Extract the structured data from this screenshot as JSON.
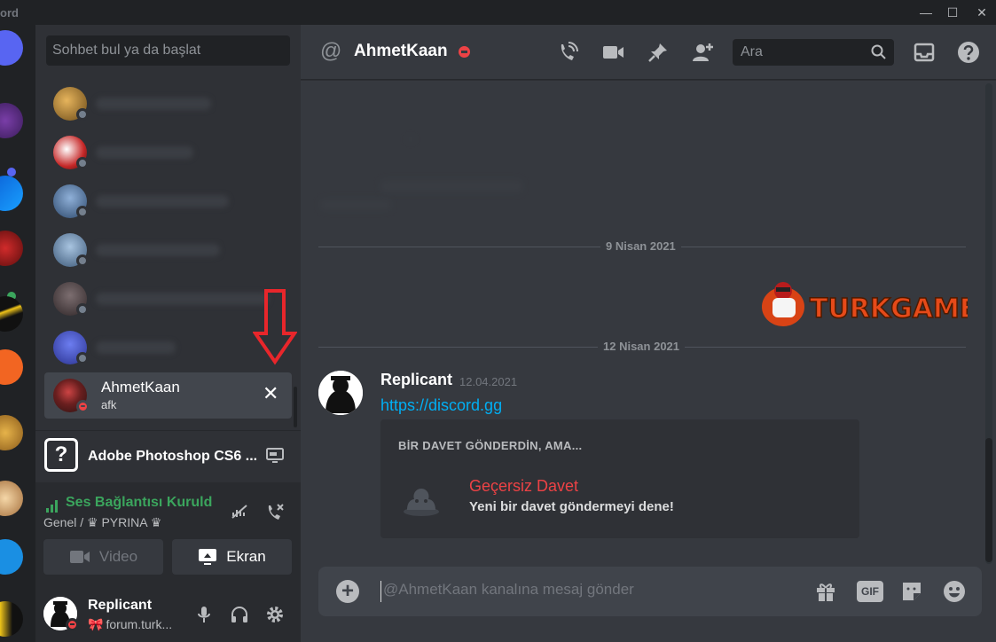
{
  "window": {
    "app_name": "ord",
    "minimize": "—",
    "maximize": "☐",
    "close": "✕"
  },
  "sidebar": {
    "search_placeholder": "Sohbet bul ya da başlat",
    "active_dm": {
      "name": "AhmetKaan",
      "status": "afk",
      "close": "✕"
    },
    "activity": {
      "icon": "?",
      "title": "Adobe Photoshop CS6 ..."
    },
    "voice": {
      "connected": "Ses Bağlantısı Kuruldu",
      "channel": "Genel / ♛ PYRINA ♛",
      "video_label": "Video",
      "screen_label": "Ekran"
    },
    "user": {
      "name": "Replicant",
      "status": "forum.turk..."
    }
  },
  "header": {
    "at": "@",
    "name": "AhmetKaan",
    "search_placeholder": "Ara"
  },
  "messages": {
    "date1": "9 Nisan 2021",
    "date2": "12 Nisan 2021",
    "banner_text": "TURKGAME",
    "author": "Replicant",
    "timestamp": "12.04.2021",
    "link": "https://discord.gg",
    "invite": {
      "heading": "BİR DAVET GÖNDERDİN, AMA...",
      "title": "Geçersiz Davet",
      "subtitle": "Yeni bir davet göndermeyi dene!"
    }
  },
  "composer": {
    "plus": "+",
    "placeholder": "@AhmetKaan kanalına mesaj gönder",
    "gif": "GIF"
  },
  "colors": {
    "accent_red": "#ed4245",
    "voice_green": "#3ba55d",
    "link": "#00aff4",
    "annotation": "#e8262b"
  }
}
